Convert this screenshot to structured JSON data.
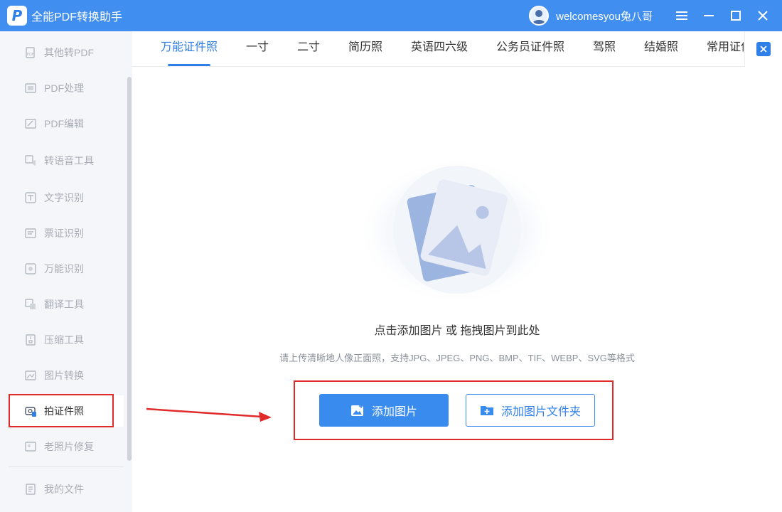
{
  "app": {
    "title": "全能PDF转换助手",
    "user_name": "welcomesyou兔八哥"
  },
  "sidebar": {
    "items": [
      {
        "label": "其他转PDF",
        "icon": "pdf-file-icon"
      },
      {
        "label": "PDF处理",
        "icon": "pdf-process-icon"
      },
      {
        "label": "PDF编辑",
        "icon": "pdf-edit-icon"
      },
      {
        "label": "转语音工具",
        "icon": "text-to-speech-icon"
      },
      {
        "label": "文字识别",
        "icon": "text-recognition-icon"
      },
      {
        "label": "票证识别",
        "icon": "ticket-recognition-icon"
      },
      {
        "label": "万能识别",
        "icon": "universal-recognition-icon"
      },
      {
        "label": "翻译工具",
        "icon": "translate-icon"
      },
      {
        "label": "压缩工具",
        "icon": "compress-icon"
      },
      {
        "label": "图片转换",
        "icon": "image-convert-icon"
      },
      {
        "label": "拍证件照",
        "icon": "id-photo-camera-icon",
        "active": true
      },
      {
        "label": "老照片修复",
        "icon": "photo-repair-icon"
      }
    ],
    "my_files": "我的文件"
  },
  "tabs": [
    {
      "label": "万能证件照",
      "active": true
    },
    {
      "label": "一寸"
    },
    {
      "label": "二寸"
    },
    {
      "label": "简历照"
    },
    {
      "label": "英语四六级"
    },
    {
      "label": "公务员证件照"
    },
    {
      "label": "驾照"
    },
    {
      "label": "结婚照"
    },
    {
      "label": "常用证件照"
    }
  ],
  "main": {
    "drop_title": "点击添加图片 或 拖拽图片到此处",
    "drop_hint": "请上传清晰地人像正面照，支持JPG、JPEG、PNG、BMP、TIF、WEBP、SVG等格式",
    "add_image_label": "添加图片",
    "add_folder_label": "添加图片文件夹"
  },
  "colors": {
    "accent": "#3a8bee",
    "titlebar": "#3f8ef0",
    "annotation_red": "#e12a2a",
    "sidebar_bg": "#f4f6f9"
  }
}
